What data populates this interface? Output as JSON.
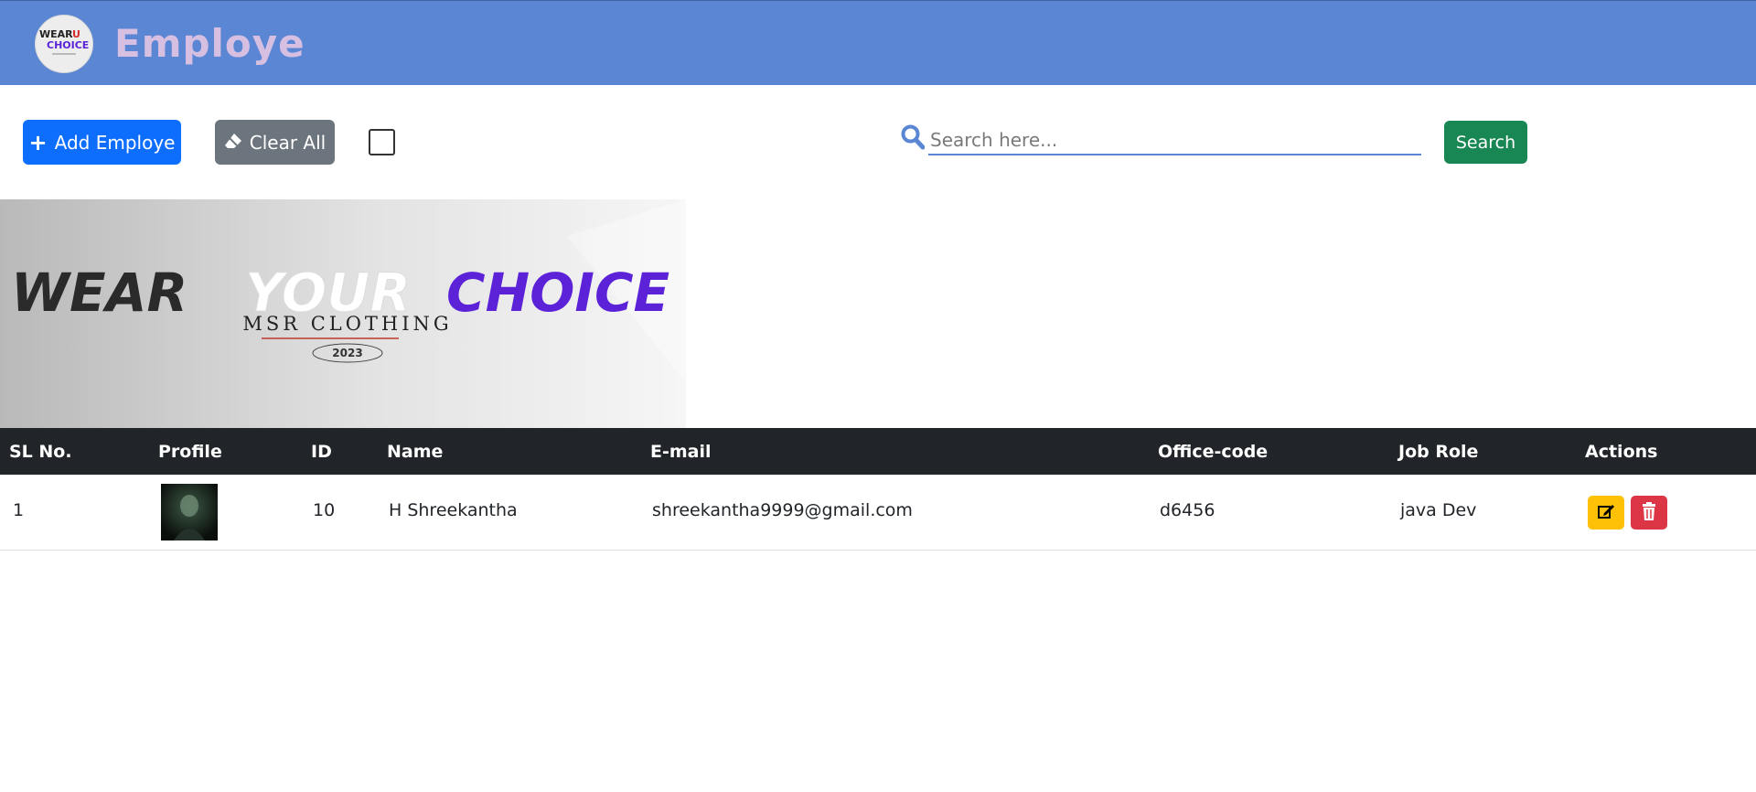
{
  "navbar": {
    "title": "Employe",
    "logo_alt": "WEAR YOU CHOICE"
  },
  "toolbar": {
    "add_label": "Add Employe",
    "clear_label": "Clear All",
    "search_placeholder": "Search here...",
    "search_value": "",
    "search_label": "Search",
    "checkbox_checked": false
  },
  "banner": {
    "line1_word1": "WEAR",
    "line1_word2": "YOUR",
    "line1_word3": "CHOICE",
    "subtitle": "MSR CLOTHING",
    "year": "2023"
  },
  "table": {
    "headers": [
      "SL No.",
      "Profile",
      "ID",
      "Name",
      "E-mail",
      "Office-code",
      "Job Role",
      "Actions"
    ],
    "rows": [
      {
        "sl": "1",
        "id": "10",
        "name": "H Shreekantha",
        "email": "shreekantha9999@gmail.com",
        "office_code": "d6456",
        "job_role": "java Dev"
      }
    ]
  },
  "colors": {
    "navbar": "#5a86d4",
    "title": "#d7bfe2",
    "primary": "#0d6efd",
    "secondary": "#6c757d",
    "success": "#198754",
    "warning": "#ffc107",
    "danger": "#dc3545",
    "table_header": "#212529"
  }
}
